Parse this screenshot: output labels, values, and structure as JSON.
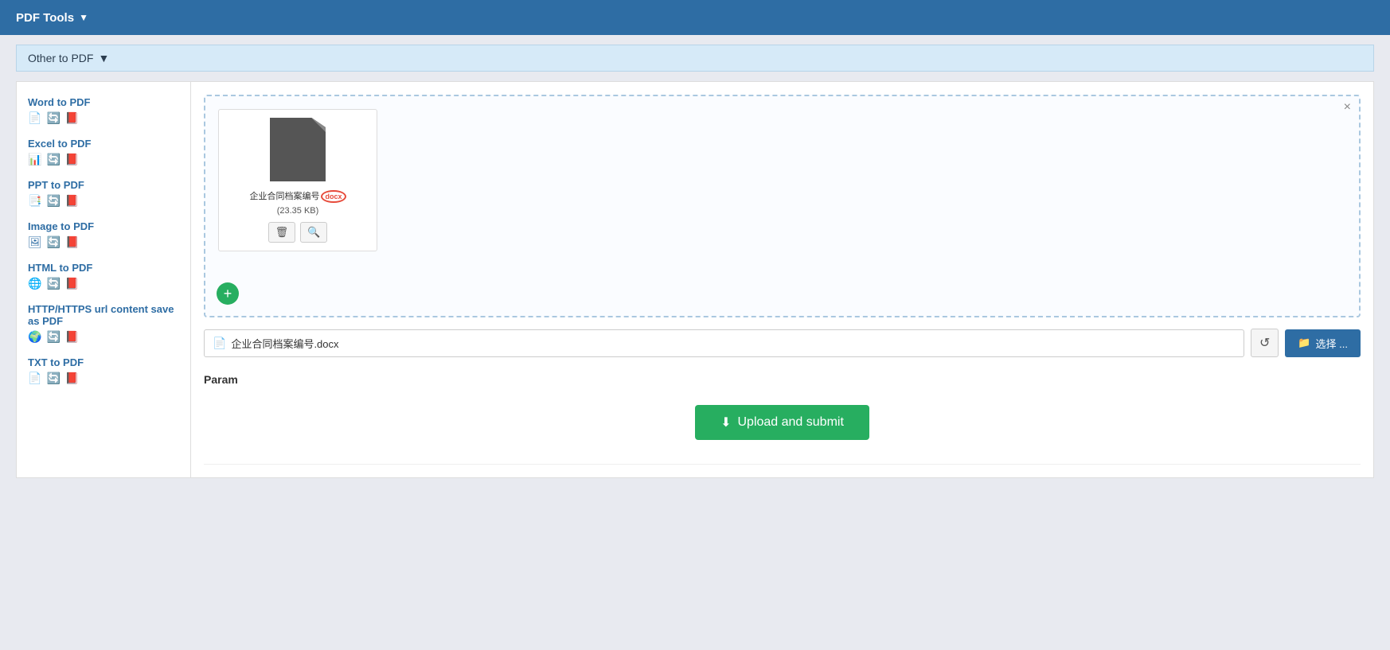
{
  "topNav": {
    "title": "PDF Tools",
    "chevron": "▼"
  },
  "sectionHeader": {
    "label": "Other to PDF",
    "chevron": "▼"
  },
  "sidebar": {
    "items": [
      {
        "id": "word-to-pdf",
        "label": "Word to PDF",
        "icons": [
          "📄",
          "🔄",
          "📕"
        ]
      },
      {
        "id": "excel-to-pdf",
        "label": "Excel to PDF",
        "icons": [
          "📊",
          "🔄",
          "📕"
        ]
      },
      {
        "id": "ppt-to-pdf",
        "label": "PPT to PDF",
        "icons": [
          "📑",
          "🔄",
          "📕"
        ]
      },
      {
        "id": "image-to-pdf",
        "label": "Image to PDF",
        "icons": [
          "🖼",
          "🔄",
          "📕"
        ]
      },
      {
        "id": "html-to-pdf",
        "label": "HTML to PDF",
        "icons": [
          "🌐",
          "🔄",
          "📕"
        ]
      },
      {
        "id": "http-to-pdf",
        "label": "HTTP/HTTPS url content save as PDF",
        "icons": [
          "🌍",
          "🔄",
          "📕"
        ]
      },
      {
        "id": "txt-to-pdf",
        "label": "TXT to PDF",
        "icons": [
          "📄",
          "🔄",
          "📕"
        ]
      }
    ]
  },
  "uploadArea": {
    "closeBtn": "×",
    "addBtn": "+",
    "fileCard": {
      "name": "企业合同档案编号",
      "badge": "docx",
      "size": "(23.35 KB)",
      "deleteIcon": "🗑",
      "zoomIcon": "🔍"
    }
  },
  "fileInputRow": {
    "filename": "企业合同档案编号.docx",
    "fileIcon": "📄",
    "resetIcon": "↺",
    "chooseBtnFolderIcon": "📁",
    "chooseBtnLabel": "选择 ..."
  },
  "paramSection": {
    "label": "Param"
  },
  "submitBtn": {
    "icon": "⬇",
    "label": "Upload and submit"
  }
}
